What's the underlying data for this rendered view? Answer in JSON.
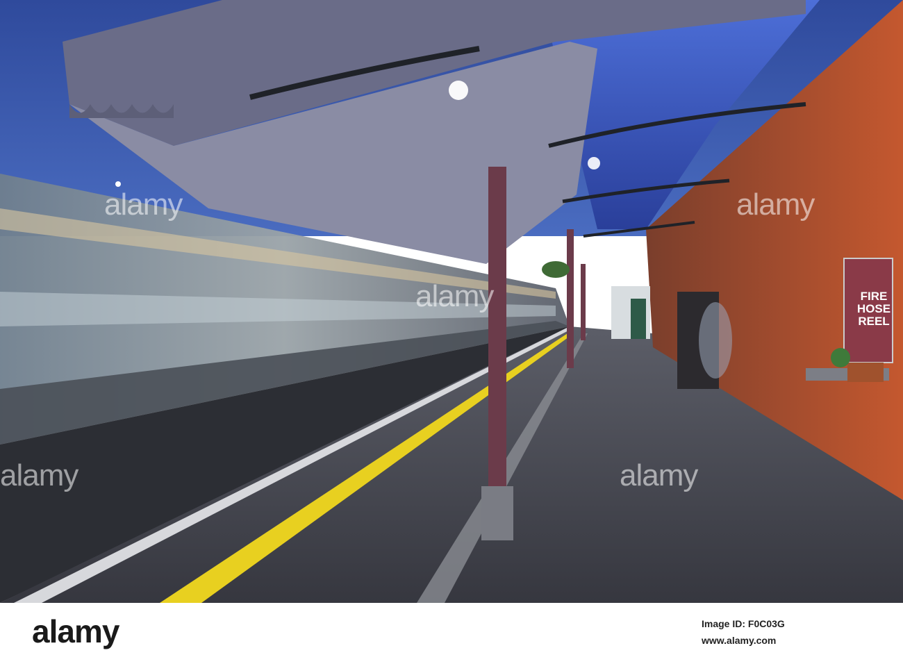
{
  "photo": {
    "sign_text": [
      "FIRE",
      "HOSE",
      "REEL"
    ],
    "watermark": "alamy"
  },
  "footer": {
    "logo": "alamy",
    "image_id_label": "Image ID: F0C03G",
    "site": "www.alamy.com"
  },
  "colors": {
    "sky": "#3a5aa8",
    "brick": "#b5502f",
    "platform": "#4a4c55",
    "yellow_line": "#e8d020",
    "canopy": "#6a6c88"
  }
}
